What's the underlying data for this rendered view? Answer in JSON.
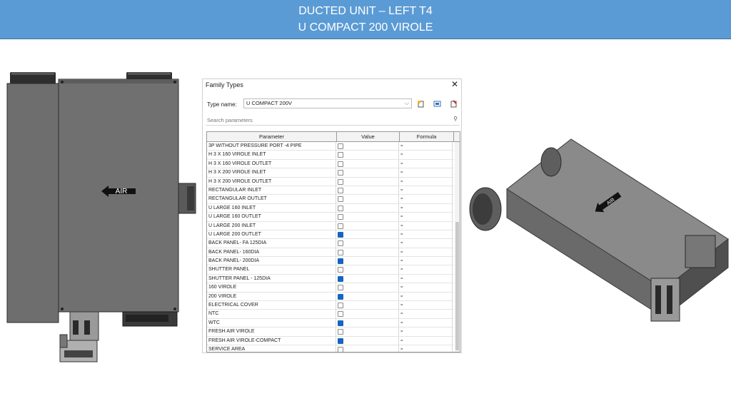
{
  "banner": {
    "line1": "DUCTED UNIT – LEFT  T4",
    "line2": "U COMPACT 200 VIROLE"
  },
  "device_left": {
    "label": "AIR"
  },
  "device_right": {
    "label": "AIR"
  },
  "dialog": {
    "title": "Family Types",
    "close_glyph": "✕",
    "type_name_label": "Type name:",
    "type_name_value": "U COMPACT 200V",
    "search_placeholder": "Search parameters",
    "columns": {
      "parameter": "Parameter",
      "value": "Value",
      "formula": "Formula"
    },
    "rows": [
      {
        "parameter": "3P WITHOUT PRESSURE PORT -4  PIPE",
        "checked": false,
        "formula": "="
      },
      {
        "parameter": "H  3 X 160 VIROLE INLET",
        "checked": false,
        "formula": "="
      },
      {
        "parameter": "H  3 X 160 VIROLE OUTLET",
        "checked": false,
        "formula": "="
      },
      {
        "parameter": "H  3 X 200 VIROLE INLET",
        "checked": false,
        "formula": "="
      },
      {
        "parameter": "H  3 X 200 VIROLE OUTLET",
        "checked": false,
        "formula": "="
      },
      {
        "parameter": "RECTANGULAR INLET",
        "checked": false,
        "formula": "="
      },
      {
        "parameter": "RECTANGULAR OUTLET",
        "checked": false,
        "formula": "="
      },
      {
        "parameter": "U LARGE 160 INLET",
        "checked": false,
        "formula": "="
      },
      {
        "parameter": "U LARGE 160 OUTLET",
        "checked": false,
        "formula": "="
      },
      {
        "parameter": "U LARGE 200 INLET",
        "checked": false,
        "formula": "="
      },
      {
        "parameter": "U LARGE 200 OUTLET",
        "checked": true,
        "formula": "="
      },
      {
        "parameter": "BACK PANEL- FA 125DIA",
        "checked": false,
        "formula": "="
      },
      {
        "parameter": "BACK PANEL- 160DIA",
        "checked": false,
        "formula": "="
      },
      {
        "parameter": "BACK PANEL- 200DIA",
        "checked": true,
        "formula": "="
      },
      {
        "parameter": "SHUTTER PANEL",
        "checked": false,
        "formula": "="
      },
      {
        "parameter": "SHUTTER PANEL - 125DIA",
        "checked": true,
        "formula": "="
      },
      {
        "parameter": "160 VIROLE",
        "checked": false,
        "formula": "="
      },
      {
        "parameter": "200 VIROLE",
        "checked": true,
        "formula": "="
      },
      {
        "parameter": "ELECTRICAL COVER",
        "checked": false,
        "formula": "="
      },
      {
        "parameter": "NTC",
        "checked": false,
        "formula": "="
      },
      {
        "parameter": "WTC",
        "checked": true,
        "formula": "="
      },
      {
        "parameter": "FRESH AIR VIROLE",
        "checked": false,
        "formula": "="
      },
      {
        "parameter": "FRESH AIR VIROLE-COMPACT",
        "checked": true,
        "formula": "="
      },
      {
        "parameter": "SERVICE AREA",
        "checked": false,
        "formula": "="
      }
    ]
  },
  "colors": {
    "banner": "#5b9bd5",
    "device_gray": "#6e6e6e",
    "check_on": "#1565c0"
  }
}
